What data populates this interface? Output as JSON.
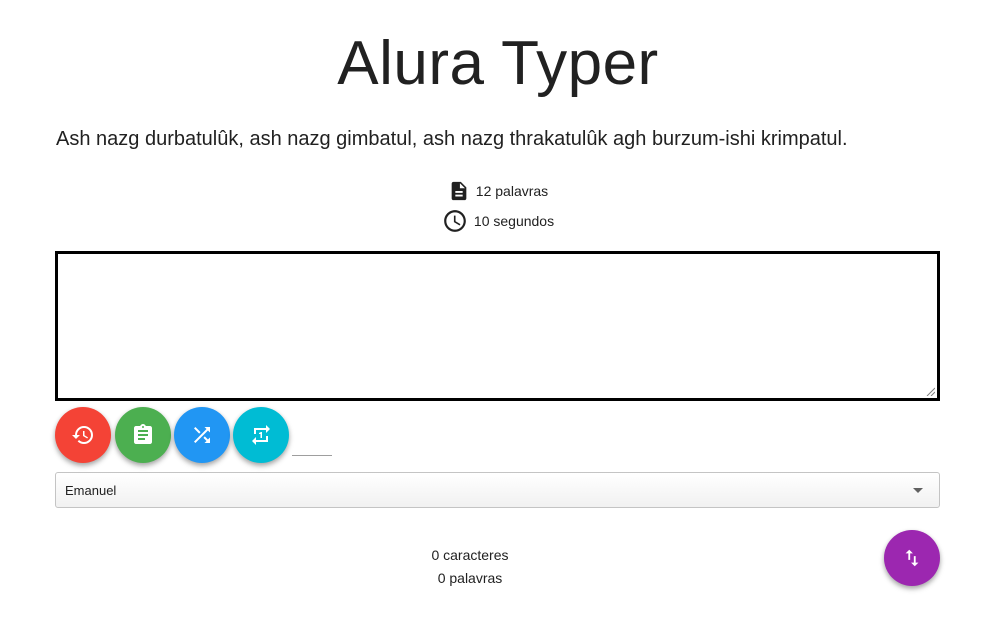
{
  "app": {
    "title": "Alura Typer"
  },
  "phrase": {
    "text": "Ash nazg durbatulûk, ash nazg gimbatul, ash nazg thrakatulûk agh burzum-ishi krimpatul."
  },
  "info": {
    "word_count_label": "12 palavras",
    "time_label": "10 segundos",
    "words_icon": "description-icon",
    "time_icon": "clock-icon"
  },
  "typing": {
    "value": "",
    "placeholder": ""
  },
  "buttons": {
    "restart": {
      "icon": "restore-icon",
      "color": "#f44336"
    },
    "scoreboard": {
      "icon": "clipboard-icon",
      "color": "#4caf50"
    },
    "shuffle": {
      "icon": "shuffle-icon",
      "color": "#2196f3"
    },
    "sync": {
      "icon": "sync-icon",
      "color": "#00bcd4"
    },
    "swap": {
      "icon": "swap-vert-icon",
      "color": "#9c27b0"
    }
  },
  "small_input": {
    "value": ""
  },
  "user_select": {
    "selected": "Emanuel"
  },
  "counters": {
    "characters": "0 caracteres",
    "words": "0 palavras"
  }
}
